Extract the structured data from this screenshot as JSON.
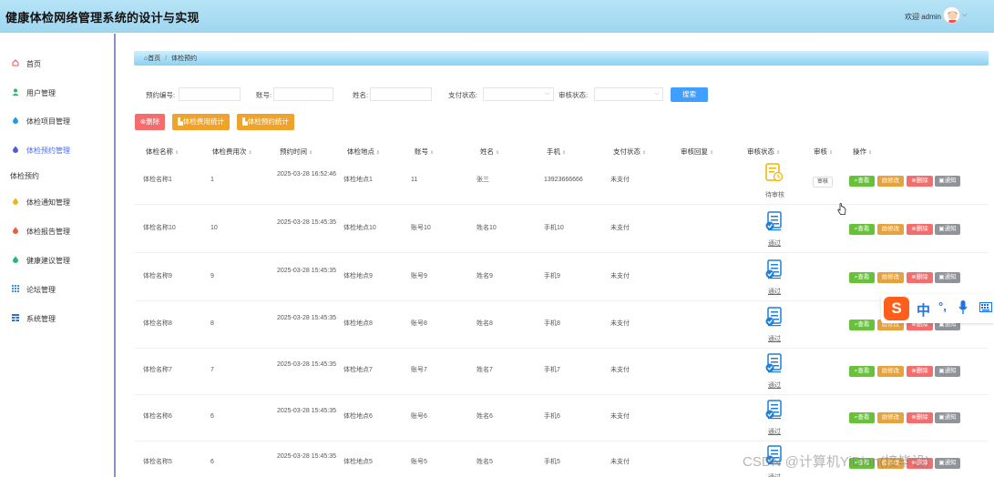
{
  "header": {
    "title": "健康体检网络管理系统的设计与实现",
    "welcome": "欢迎 admin"
  },
  "sidebar": {
    "items": [
      {
        "label": "首页",
        "icon": "home-icon"
      },
      {
        "label": "用户管理",
        "icon": "user-icon"
      },
      {
        "label": "体检项目管理",
        "icon": "drop-icon"
      },
      {
        "label": "体检预约管理",
        "icon": "drop-icon"
      }
    ],
    "group_label": "体检预约",
    "items2": [
      {
        "label": "体检通知管理",
        "icon": "drop-icon"
      },
      {
        "label": "体检报告管理",
        "icon": "drop-icon"
      },
      {
        "label": "健康建议管理",
        "icon": "drop-icon"
      },
      {
        "label": "论坛管理",
        "icon": "grid-icon"
      },
      {
        "label": "系统管理",
        "icon": "grid-icon"
      }
    ]
  },
  "breadcrumb": {
    "home": "⌂首页",
    "separator": "/",
    "current": "体检预约"
  },
  "filters": {
    "appointment_no": "预约编号:",
    "account": "账号:",
    "name": "姓名:",
    "pay_status": "支付状态:",
    "review_status": "审核状态:",
    "search": "搜索"
  },
  "actions": {
    "delete": "删除",
    "fee_stats": "体检费用统计",
    "appt_stats": "体检预约统计"
  },
  "table": {
    "headers": [
      "体检名称",
      "体检费用次",
      "预约时间",
      "体检地点",
      "账号",
      "姓名",
      "手机",
      "支付状态",
      "审核回复",
      "审核状态",
      "审核",
      "操作"
    ],
    "rows": [
      {
        "name": "体检名称1",
        "fee": "1",
        "time": "2025-03-28 16:52:46",
        "place": "体检地点1",
        "account": "11",
        "person": "张三",
        "phone": "13923666666",
        "pay": "未支付",
        "status": "待审核",
        "review": "审核"
      },
      {
        "name": "体检名称10",
        "fee": "10",
        "time": "2025-03-28 15:45:35",
        "place": "体检地点10",
        "account": "账号10",
        "person": "姓名10",
        "phone": "手机10",
        "pay": "未支付",
        "status": "通过"
      },
      {
        "name": "体检名称9",
        "fee": "9",
        "time": "2025-03-28 15:45:35",
        "place": "体检地点9",
        "account": "账号9",
        "person": "姓名9",
        "phone": "手机9",
        "pay": "未支付",
        "status": "通过"
      },
      {
        "name": "体检名称8",
        "fee": "8",
        "time": "2025-03-28 15:45:35",
        "place": "体检地点8",
        "account": "账号8",
        "person": "姓名8",
        "phone": "手机8",
        "pay": "未支付",
        "status": "通过"
      },
      {
        "name": "体检名称7",
        "fee": "7",
        "time": "2025-03-28 15:45:35",
        "place": "体检地点7",
        "account": "账号7",
        "person": "姓名7",
        "phone": "手机7",
        "pay": "未支付",
        "status": "通过"
      },
      {
        "name": "体检名称6",
        "fee": "6",
        "time": "2025-03-28 15:45:35",
        "place": "体检地点6",
        "account": "账号6",
        "person": "姓名6",
        "phone": "手机6",
        "pay": "未支付",
        "status": "通过"
      },
      {
        "name": "体检名称5",
        "fee": "6",
        "time": "2025-03-28 15:45:35",
        "place": "体检地点5",
        "account": "账号5",
        "person": "姓名5",
        "phone": "手机5",
        "pay": "未支付",
        "status": "通过"
      }
    ],
    "ops": [
      "查看",
      "修改",
      "删除",
      "通知"
    ]
  },
  "ime": {
    "logo": "S",
    "lang": "中",
    "punct": "°,"
  },
  "watermark": "CSDN @计算机YiDian(接毕设)",
  "colors": {
    "accent": "#409eff",
    "delete": "#f56c6c",
    "stats": "#f0a32a",
    "view": "#67c23a",
    "edit": "#e6a23c",
    "notify": "#909399"
  }
}
